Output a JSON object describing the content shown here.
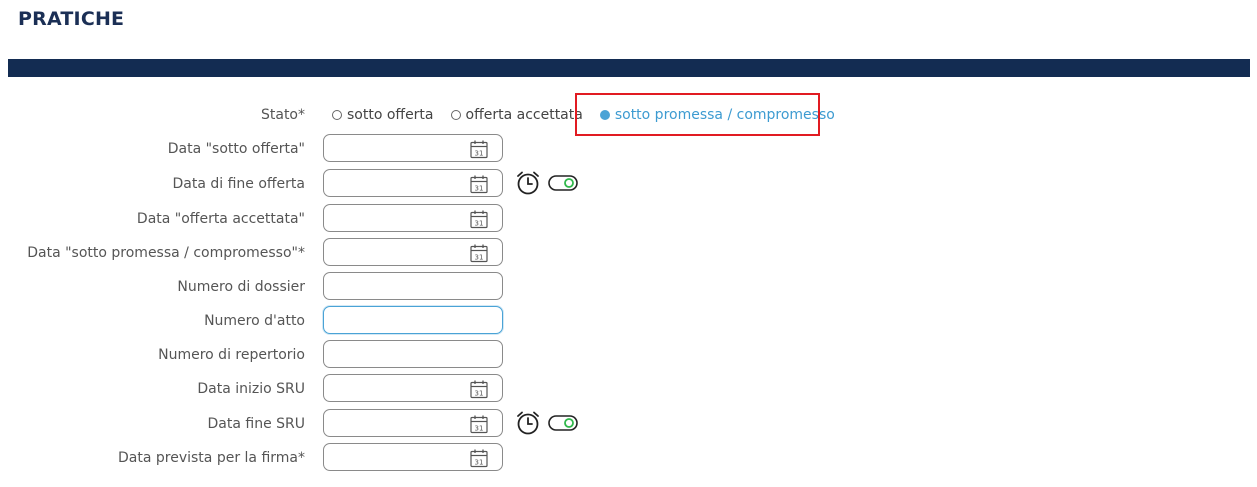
{
  "page": {
    "title": "PRATICHE"
  },
  "stato": {
    "label": "Stato*",
    "options": [
      {
        "label": "sotto offerta",
        "selected": false
      },
      {
        "label": "offerta accettata",
        "selected": false
      },
      {
        "label": "sotto promessa / compromesso",
        "selected": true
      }
    ]
  },
  "fields": {
    "data_sotto_offerta": {
      "label": "Data \"sotto offerta\"",
      "value": ""
    },
    "data_fine_offerta": {
      "label": "Data di fine offerta",
      "value": ""
    },
    "data_offerta_accettata": {
      "label": "Data \"offerta accettata\"",
      "value": ""
    },
    "data_sotto_promessa": {
      "label": "Data \"sotto promessa / compromesso\"*",
      "value": ""
    },
    "numero_dossier": {
      "label": "Numero di dossier",
      "value": ""
    },
    "numero_atto": {
      "label": "Numero d'atto",
      "value": ""
    },
    "numero_repertorio": {
      "label": "Numero di repertorio",
      "value": ""
    },
    "data_inizio_sru": {
      "label": "Data inizio SRU",
      "value": ""
    },
    "data_fine_sru": {
      "label": "Data fine SRU",
      "value": ""
    },
    "data_prevista_firma": {
      "label": "Data prevista per la firma*",
      "value": ""
    }
  },
  "icons": {
    "calendar_day": "31",
    "calendar": "calendar-icon",
    "alarm": "alarm-clock-icon",
    "toggle": "toggle-icon"
  },
  "colors": {
    "header": "#132c52",
    "accent": "#4aa3d6",
    "highlight": "#e11b22",
    "toggle_on": "#2fb84a"
  }
}
